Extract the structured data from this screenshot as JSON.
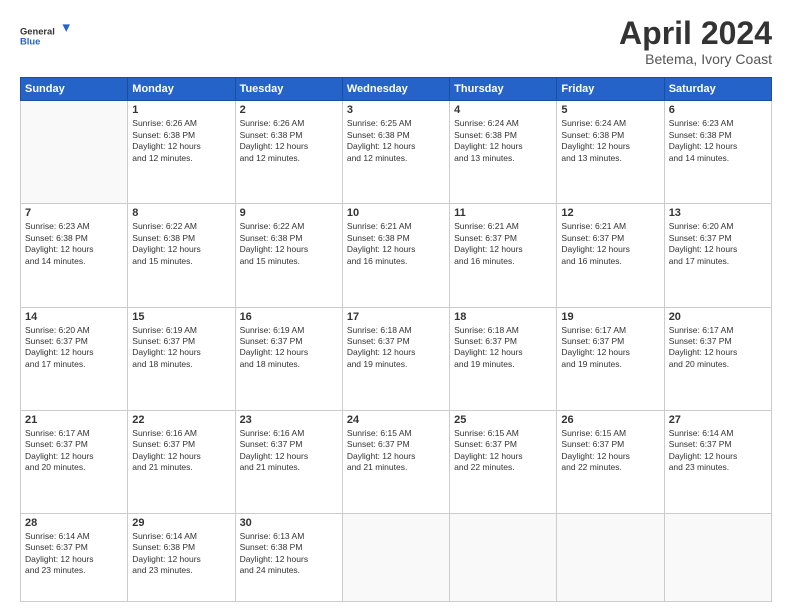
{
  "header": {
    "logo": {
      "line1": "General",
      "line2": "Blue"
    },
    "title": "April 2024",
    "location": "Betema, Ivory Coast"
  },
  "weekdays": [
    "Sunday",
    "Monday",
    "Tuesday",
    "Wednesday",
    "Thursday",
    "Friday",
    "Saturday"
  ],
  "weeks": [
    [
      {
        "day": "",
        "info": ""
      },
      {
        "day": "1",
        "info": "Sunrise: 6:26 AM\nSunset: 6:38 PM\nDaylight: 12 hours\nand 12 minutes."
      },
      {
        "day": "2",
        "info": "Sunrise: 6:26 AM\nSunset: 6:38 PM\nDaylight: 12 hours\nand 12 minutes."
      },
      {
        "day": "3",
        "info": "Sunrise: 6:25 AM\nSunset: 6:38 PM\nDaylight: 12 hours\nand 12 minutes."
      },
      {
        "day": "4",
        "info": "Sunrise: 6:24 AM\nSunset: 6:38 PM\nDaylight: 12 hours\nand 13 minutes."
      },
      {
        "day": "5",
        "info": "Sunrise: 6:24 AM\nSunset: 6:38 PM\nDaylight: 12 hours\nand 13 minutes."
      },
      {
        "day": "6",
        "info": "Sunrise: 6:23 AM\nSunset: 6:38 PM\nDaylight: 12 hours\nand 14 minutes."
      }
    ],
    [
      {
        "day": "7",
        "info": "Sunrise: 6:23 AM\nSunset: 6:38 PM\nDaylight: 12 hours\nand 14 minutes."
      },
      {
        "day": "8",
        "info": "Sunrise: 6:22 AM\nSunset: 6:38 PM\nDaylight: 12 hours\nand 15 minutes."
      },
      {
        "day": "9",
        "info": "Sunrise: 6:22 AM\nSunset: 6:38 PM\nDaylight: 12 hours\nand 15 minutes."
      },
      {
        "day": "10",
        "info": "Sunrise: 6:21 AM\nSunset: 6:38 PM\nDaylight: 12 hours\nand 16 minutes."
      },
      {
        "day": "11",
        "info": "Sunrise: 6:21 AM\nSunset: 6:37 PM\nDaylight: 12 hours\nand 16 minutes."
      },
      {
        "day": "12",
        "info": "Sunrise: 6:21 AM\nSunset: 6:37 PM\nDaylight: 12 hours\nand 16 minutes."
      },
      {
        "day": "13",
        "info": "Sunrise: 6:20 AM\nSunset: 6:37 PM\nDaylight: 12 hours\nand 17 minutes."
      }
    ],
    [
      {
        "day": "14",
        "info": "Sunrise: 6:20 AM\nSunset: 6:37 PM\nDaylight: 12 hours\nand 17 minutes."
      },
      {
        "day": "15",
        "info": "Sunrise: 6:19 AM\nSunset: 6:37 PM\nDaylight: 12 hours\nand 18 minutes."
      },
      {
        "day": "16",
        "info": "Sunrise: 6:19 AM\nSunset: 6:37 PM\nDaylight: 12 hours\nand 18 minutes."
      },
      {
        "day": "17",
        "info": "Sunrise: 6:18 AM\nSunset: 6:37 PM\nDaylight: 12 hours\nand 19 minutes."
      },
      {
        "day": "18",
        "info": "Sunrise: 6:18 AM\nSunset: 6:37 PM\nDaylight: 12 hours\nand 19 minutes."
      },
      {
        "day": "19",
        "info": "Sunrise: 6:17 AM\nSunset: 6:37 PM\nDaylight: 12 hours\nand 19 minutes."
      },
      {
        "day": "20",
        "info": "Sunrise: 6:17 AM\nSunset: 6:37 PM\nDaylight: 12 hours\nand 20 minutes."
      }
    ],
    [
      {
        "day": "21",
        "info": "Sunrise: 6:17 AM\nSunset: 6:37 PM\nDaylight: 12 hours\nand 20 minutes."
      },
      {
        "day": "22",
        "info": "Sunrise: 6:16 AM\nSunset: 6:37 PM\nDaylight: 12 hours\nand 21 minutes."
      },
      {
        "day": "23",
        "info": "Sunrise: 6:16 AM\nSunset: 6:37 PM\nDaylight: 12 hours\nand 21 minutes."
      },
      {
        "day": "24",
        "info": "Sunrise: 6:15 AM\nSunset: 6:37 PM\nDaylight: 12 hours\nand 21 minutes."
      },
      {
        "day": "25",
        "info": "Sunrise: 6:15 AM\nSunset: 6:37 PM\nDaylight: 12 hours\nand 22 minutes."
      },
      {
        "day": "26",
        "info": "Sunrise: 6:15 AM\nSunset: 6:37 PM\nDaylight: 12 hours\nand 22 minutes."
      },
      {
        "day": "27",
        "info": "Sunrise: 6:14 AM\nSunset: 6:37 PM\nDaylight: 12 hours\nand 23 minutes."
      }
    ],
    [
      {
        "day": "28",
        "info": "Sunrise: 6:14 AM\nSunset: 6:37 PM\nDaylight: 12 hours\nand 23 minutes."
      },
      {
        "day": "29",
        "info": "Sunrise: 6:14 AM\nSunset: 6:38 PM\nDaylight: 12 hours\nand 23 minutes."
      },
      {
        "day": "30",
        "info": "Sunrise: 6:13 AM\nSunset: 6:38 PM\nDaylight: 12 hours\nand 24 minutes."
      },
      {
        "day": "",
        "info": ""
      },
      {
        "day": "",
        "info": ""
      },
      {
        "day": "",
        "info": ""
      },
      {
        "day": "",
        "info": ""
      }
    ]
  ]
}
